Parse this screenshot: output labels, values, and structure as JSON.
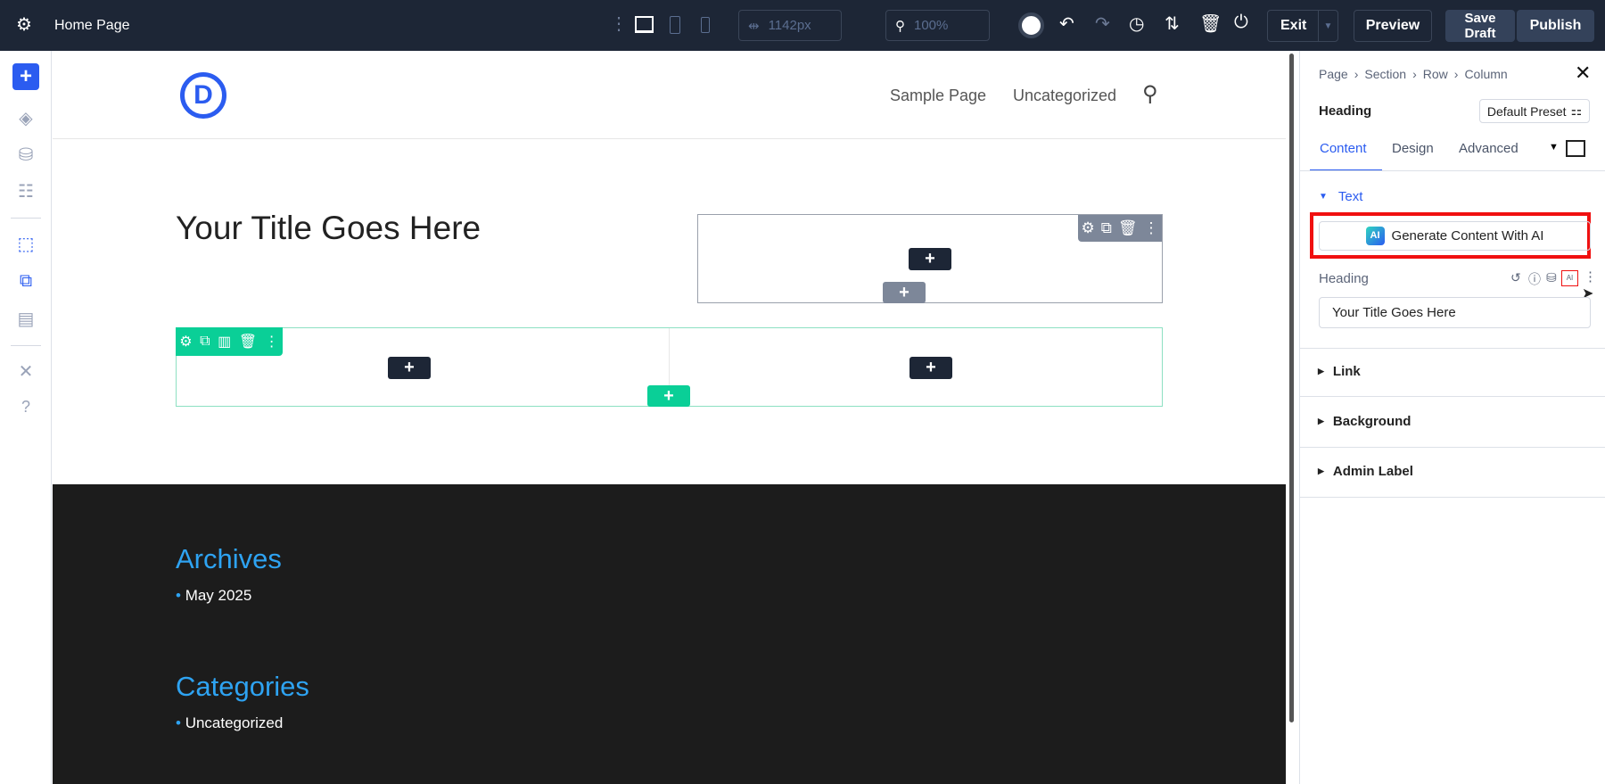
{
  "topbar": {
    "page_title": "Home Page",
    "width_value": "1142px",
    "zoom_value": "100%",
    "exit_label": "Exit",
    "preview_label": "Preview",
    "save_draft_label": "Save Draft",
    "publish_label": "Publish"
  },
  "site": {
    "logo_letter": "D",
    "nav": [
      "Sample Page",
      "Uncategorized"
    ],
    "title": "Your Title Goes Here",
    "footer": {
      "archives_title": "Archives",
      "archives_items": [
        "May 2025"
      ],
      "categories_title": "Categories",
      "categories_items": [
        "Uncategorized"
      ]
    }
  },
  "panel": {
    "breadcrumb": [
      "Page",
      "Section",
      "Row",
      "Column"
    ],
    "module_name": "Heading",
    "preset_label": "Default Preset",
    "tabs": [
      "Content",
      "Design",
      "Advanced"
    ],
    "text_section": "Text",
    "ai_button_label": "Generate Content With AI",
    "ai_badge": "AI",
    "heading_label": "Heading",
    "heading_value": "Your Title Goes Here",
    "sections": [
      "Link",
      "Background",
      "Admin Label"
    ]
  },
  "colors": {
    "accent": "#2b5cf0",
    "teal": "#0acf97",
    "topbar": "#1d2636",
    "footer": "#1c1c1c",
    "link_blue": "#2ea3f2",
    "highlight": "#f01010"
  }
}
